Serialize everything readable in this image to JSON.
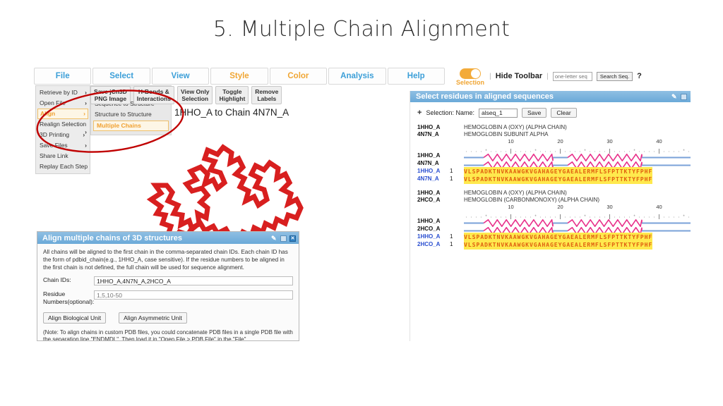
{
  "slide": {
    "title": "5. Multiple Chain Alignment"
  },
  "menubar": {
    "tabs": [
      {
        "label": "File",
        "accent": "#3c9fd8"
      },
      {
        "label": "Select",
        "accent": "#3c9fd8"
      },
      {
        "label": "View",
        "accent": "#3c9fd8"
      },
      {
        "label": "Style",
        "accent": "#f0a634"
      },
      {
        "label": "Color",
        "accent": "#f0a634"
      },
      {
        "label": "Analysis",
        "accent": "#3c9fd8"
      },
      {
        "label": "Help",
        "accent": "#3c9fd8"
      }
    ],
    "selection_toggle_label": "Selection",
    "hide_toolbar_label": "Hide Toolbar",
    "seq_search_placeholder": "one-letter seq",
    "seq_search_value": "",
    "search_seq_label": "Search Seq.",
    "help_glyph": "?"
  },
  "file_menu": {
    "items": [
      {
        "label": "Retrieve by ID",
        "submenu": true,
        "selected": false
      },
      {
        "label": "Open File",
        "submenu": true,
        "selected": false
      },
      {
        "label": "Align",
        "submenu": true,
        "selected": true
      },
      {
        "label": "Realign Selection",
        "submenu": true,
        "selected": false
      },
      {
        "label": "3D Printing",
        "submenu": true,
        "selected": false
      },
      {
        "label": "Save Files",
        "submenu": true,
        "selected": false
      },
      {
        "label": "Share Link",
        "submenu": false,
        "selected": false
      },
      {
        "label": "Replay Each Step",
        "submenu": false,
        "selected": false
      }
    ]
  },
  "align_submenu": {
    "items": [
      {
        "label": "Sequence to Structure",
        "selected": false
      },
      {
        "label": "Structure to Structure",
        "selected": false
      },
      {
        "label": "Multiple Chains",
        "selected": true
      }
    ]
  },
  "toolbar2": {
    "buttons": [
      {
        "line1": "Save jCn3D",
        "line2": "PNG Image"
      },
      {
        "line1": "H-Bonds &",
        "line2": "Interactions"
      },
      {
        "line1": "View Only",
        "line2": "Selection"
      },
      {
        "line1": "Toggle",
        "line2": "Highlight"
      },
      {
        "line1": "Remove",
        "line2": "Labels"
      }
    ]
  },
  "viewer": {
    "title": "nt of Chain 1HHO_A to Chain 4N7N_A",
    "structure_color": "#d81f1f"
  },
  "align_dialog": {
    "title": "Align multiple chains of 3D structures",
    "description": "All chains will be aligned to the first chain in the comma-separated chain IDs. Each chain ID has the form of pdbid_chain(e.g., 1HHO_A, case sensitive). If the residue numbers to be aligned in the first chain is not defined, the full chain will be used for sequence alignment.",
    "chain_ids_label": "Chain IDs:",
    "chain_ids_value": "1HHO_A,4N7N_A,2HCO_A",
    "residue_numbers_label": "Residue Numbers(optional):",
    "residue_numbers_placeholder": "1,5,10-50",
    "residue_numbers_value": "",
    "btn_biological": "Align Biological Unit",
    "btn_asymmetric": "Align Asymmetric Unit",
    "note": "(Note: To align chains in custom PDB files, you could concatenate PDB files in a single PDB file with the separation line \"ENDMDL\". Then load it in \"Open File > PDB File\" in the \"File\""
  },
  "seq_panel": {
    "header": "Select residues in aligned sequences",
    "selection_label": "Selection: Name:",
    "selection_name_value": "alseq_1",
    "save_label": "Save",
    "clear_label": "Clear",
    "ruler_numbers": [
      10,
      20,
      30,
      40
    ],
    "blocks": [
      {
        "names": [
          {
            "id": "1HHO_A",
            "desc": "HEMOGLOBIN A (OXY) (ALPHA CHAIN)"
          },
          {
            "id": "4N7N_A",
            "desc": "HEMOGLOBIN SUBUNIT ALPHA"
          }
        ],
        "ss_rows": [
          "1HHO_A",
          "4N7N_A"
        ],
        "seq_rows": [
          {
            "id": "1HHO_A",
            "start": "1",
            "letters": "VLSPADKTNVKAAWGKVGAHAGEYGAEALERMFLSFPTTKTYFPHF",
            "color": "#2a4fd0"
          },
          {
            "id": "4N7N_A",
            "start": "1",
            "letters": "VLSPADKTNVKAAWGKVGAHAGEYGAEALERMFLSFPTTKTYFPHF",
            "color": "#2a4fd0"
          }
        ]
      },
      {
        "names": [
          {
            "id": "1HHO_A",
            "desc": "HEMOGLOBIN A (OXY) (ALPHA CHAIN)"
          },
          {
            "id": "2HCO_A",
            "desc": "HEMOGLOBIN (CARBONMONOXY) (ALPHA CHAIN)"
          }
        ],
        "ss_rows": [
          "1HHO_A",
          "2HCO_A"
        ],
        "seq_rows": [
          {
            "id": "1HHO_A",
            "start": "1",
            "letters": "VLSPADKTNVKAAWGKVGAHAGEYGAEALERMFLSFPTTKTYFPHF",
            "color": "#2a4fd0"
          },
          {
            "id": "2HCO_A",
            "start": "1",
            "letters": "VLSPADKTNVKAAWGKVGAHAGEYGAEALERMFLSFPTTKTYFPHF",
            "color": "#2a4fd0"
          }
        ]
      }
    ],
    "colors": {
      "highlight_bg": "#ffe94d",
      "residue_text": "#e06010",
      "helix": "#e8308a",
      "coil": "#7aa2d8",
      "header_bg": "#6aa9d8"
    }
  },
  "annotation": {
    "shape": "ellipse",
    "color": "#c00000"
  }
}
